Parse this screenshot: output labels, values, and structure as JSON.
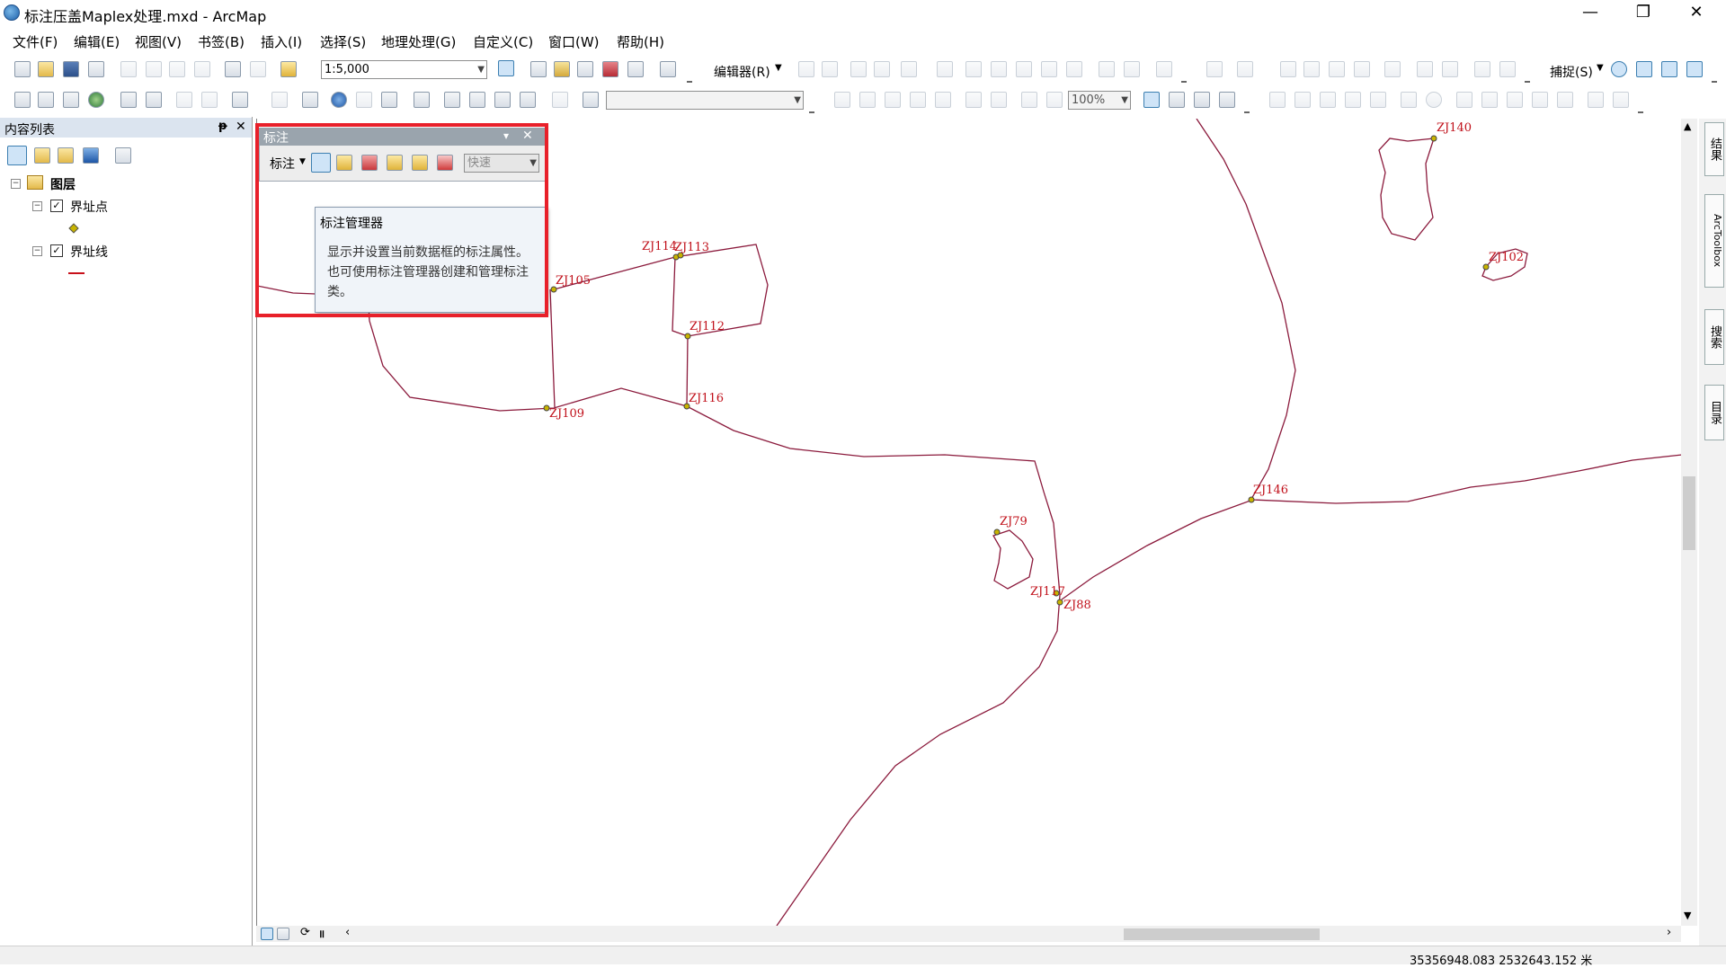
{
  "window": {
    "title": "标注压盖Maplex处理.mxd - ArcMap",
    "minimize": "—",
    "restore": "❐",
    "close": "✕"
  },
  "menus": [
    "文件(F)",
    "编辑(E)",
    "视图(V)",
    "书签(B)",
    "插入(I)",
    "选择(S)",
    "地理处理(G)",
    "自定义(C)",
    "窗口(W)",
    "帮助(H)"
  ],
  "toolbar": {
    "scale_value": "1:5,000",
    "editor_label": "编辑器(R)",
    "snap_label": "捕捉(S)",
    "zoom_value": "100%"
  },
  "toc": {
    "title": "内容列表",
    "pin": "ᵽ",
    "close": "✕",
    "root_label": "图层",
    "layers": [
      {
        "name": "界址点",
        "checked": true,
        "symbol": "point"
      },
      {
        "name": "界址线",
        "checked": true,
        "symbol": "line"
      }
    ]
  },
  "labeling_toolbar": {
    "title": "标注",
    "menu_label": "标注",
    "quick_combo": "快速",
    "dropdown": "▾",
    "close": "✕"
  },
  "tooltip": {
    "title": "标注管理器",
    "body": "显示并设置当前数据框的标注属性。也可使用标注管理器创建和管理标注类。"
  },
  "right_dock": [
    "结果",
    "ArcToolbox",
    "搜索",
    "目录"
  ],
  "status": {
    "coordinates": "35356948.083  2532643.152 米"
  },
  "map": {
    "line_color": "#8b1a3c",
    "label_color": "#c0101a",
    "point_color": "#c8b400",
    "labels": [
      "ZJ140",
      "ZJ102",
      "ZJ114",
      "ZJ113",
      "ZJ105",
      "ZJ112",
      "ZJ109",
      "ZJ116",
      "ZJ146",
      "ZJ79",
      "ZJ117",
      "ZJ88"
    ]
  }
}
